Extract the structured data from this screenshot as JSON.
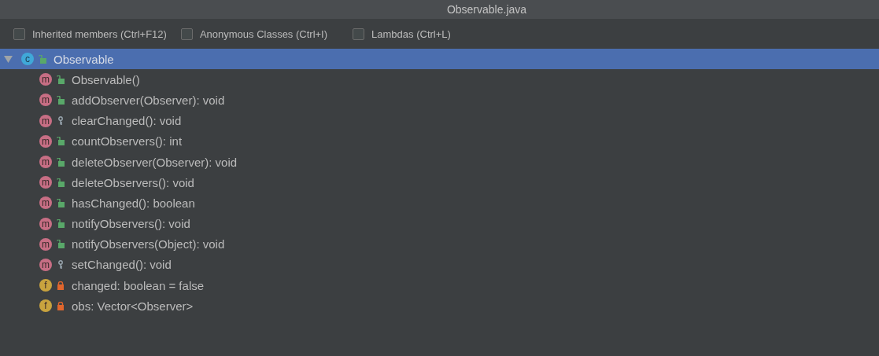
{
  "window": {
    "title": "Observable.java"
  },
  "options": [
    {
      "label": "Inherited members (Ctrl+F12)",
      "checked": false
    },
    {
      "label": "Anonymous Classes (Ctrl+I)",
      "checked": false
    },
    {
      "label": "Lambdas (Ctrl+L)",
      "checked": false
    }
  ],
  "tree": {
    "root": {
      "label": "Observable",
      "icon_letter": "c",
      "access": {
        "kind": "public"
      },
      "expanded": true,
      "selected": true,
      "children": [
        {
          "kind": "method",
          "icon_letter": "m",
          "access": {
            "kind": "public"
          },
          "label": "Observable()"
        },
        {
          "kind": "method",
          "icon_letter": "m",
          "access": {
            "kind": "public"
          },
          "label": "addObserver(Observer): void"
        },
        {
          "kind": "method",
          "icon_letter": "m",
          "access": {
            "kind": "protected"
          },
          "label": "clearChanged(): void"
        },
        {
          "kind": "method",
          "icon_letter": "m",
          "access": {
            "kind": "public"
          },
          "label": "countObservers(): int"
        },
        {
          "kind": "method",
          "icon_letter": "m",
          "access": {
            "kind": "public"
          },
          "label": "deleteObserver(Observer): void"
        },
        {
          "kind": "method",
          "icon_letter": "m",
          "access": {
            "kind": "public"
          },
          "label": "deleteObservers(): void"
        },
        {
          "kind": "method",
          "icon_letter": "m",
          "access": {
            "kind": "public"
          },
          "label": "hasChanged(): boolean"
        },
        {
          "kind": "method",
          "icon_letter": "m",
          "access": {
            "kind": "public"
          },
          "label": "notifyObservers(): void"
        },
        {
          "kind": "method",
          "icon_letter": "m",
          "access": {
            "kind": "public"
          },
          "label": "notifyObservers(Object): void"
        },
        {
          "kind": "method",
          "icon_letter": "m",
          "access": {
            "kind": "protected"
          },
          "label": "setChanged(): void"
        },
        {
          "kind": "field",
          "icon_letter": "f",
          "access": {
            "kind": "private"
          },
          "label": "changed: boolean = false"
        },
        {
          "kind": "field",
          "icon_letter": "f",
          "access": {
            "kind": "private"
          },
          "label": "obs: Vector<Observer>"
        }
      ]
    }
  }
}
